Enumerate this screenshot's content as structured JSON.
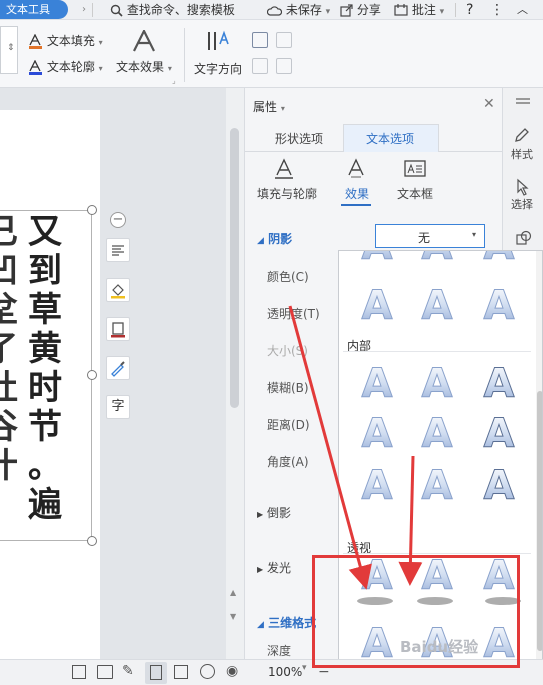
{
  "topbar": {
    "tab_label": "文本工具",
    "search_label": "查找命令、搜索模板",
    "unsaved_label": "未保存",
    "share_label": "分享",
    "comment_label": "批注"
  },
  "ribbon": {
    "text_fill": "文本填充",
    "text_outline": "文本轮廓",
    "text_effect": "文本效果",
    "text_direction": "文字方向"
  },
  "document": {
    "col_main": [
      "又",
      "到",
      "草",
      "黄",
      "时",
      "节",
      "。",
      "遍"
    ],
    "col_partial": [
      "已",
      "凹",
      "坌",
      "了",
      "杜",
      "谷",
      "什"
    ]
  },
  "properties": {
    "title": "属性",
    "tab_shape": "形状选项",
    "tab_text": "文本选项",
    "sub_fill": "填充与轮廓",
    "sub_effect": "效果",
    "sub_textbox": "文本框",
    "section_shadow": "阴影",
    "shadow_value": "无",
    "color_label": "颜色(C)",
    "transparency_label": "透明度(T)",
    "size_label": "大小(S)",
    "blur_label": "模糊(B)",
    "distance_label": "距离(D)",
    "angle_label": "角度(A)",
    "section_reflection": "倒影",
    "section_glow": "发光",
    "section_3d": "三维格式",
    "depth_label": "深度"
  },
  "right_strip": {
    "style_label": "样式",
    "select_label": "选择"
  },
  "dropdown": {
    "section_inner": "内部",
    "section_perspective": "透视",
    "letter": "A"
  },
  "statusbar": {
    "zoom": "100%"
  },
  "watermark": "Baidu经验",
  "colors": {
    "accent": "#3a82d8",
    "annotation_red": "#e23a3a"
  }
}
